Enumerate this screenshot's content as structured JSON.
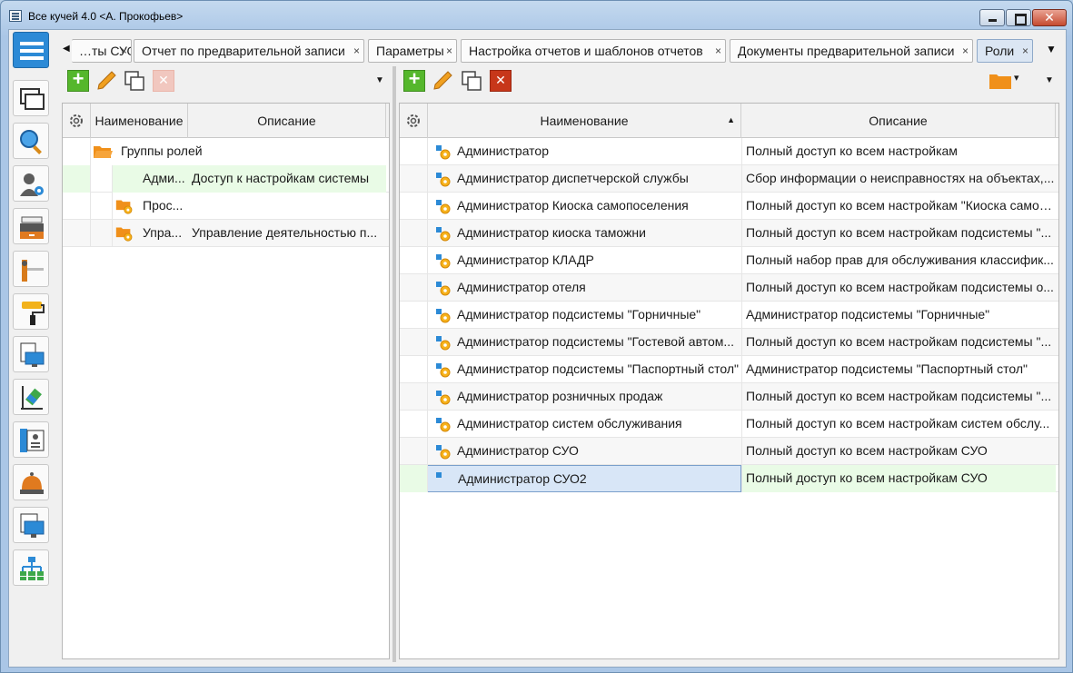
{
  "window": {
    "title": "Все кучей 4.0 <А. Прокофьев>"
  },
  "tabs": [
    {
      "label": "…ты СУО",
      "close": "×"
    },
    {
      "label": "Отчет по предварительной записи",
      "close": "×"
    },
    {
      "label": "Параметры",
      "close": "×"
    },
    {
      "label": "Настройка отчетов и шаблонов отчетов",
      "close": "×"
    },
    {
      "label": "Документы предварительной записи",
      "close": "×"
    },
    {
      "label": "Роли",
      "close": "×"
    }
  ],
  "tab_nav": {
    "left": "◀",
    "menu": "▼"
  },
  "left_panel": {
    "columns": {
      "name": "Наименование",
      "desc": "Описание"
    },
    "group": "Группы ролей",
    "rows": [
      {
        "name": "Адми...",
        "desc": "Доступ к настройкам системы"
      },
      {
        "name": "Прос...",
        "desc": ""
      },
      {
        "name": "Упра...",
        "desc": "Управление деятельностью п..."
      }
    ],
    "dropdown": "▼"
  },
  "right_panel": {
    "columns": {
      "name": "Наименование",
      "sort": "▲",
      "desc": "Описание"
    },
    "rows": [
      {
        "name": "Администратор",
        "desc": "Полный доступ ко всем настройкам"
      },
      {
        "name": "Администратор диспетчерской службы",
        "desc": "Сбор информации о неисправностях на объектах,..."
      },
      {
        "name": "Администратор Киоска самопоселения",
        "desc": "Полный доступ ко всем настройкам \"Киоска самоп..."
      },
      {
        "name": "Администратор киоска таможни",
        "desc": "Полный доступ ко всем настройкам подсистемы \"..."
      },
      {
        "name": "Администратор КЛАДР",
        "desc": "Полный набор прав для обслуживания классифик..."
      },
      {
        "name": "Администратор отеля",
        "desc": "Полный доступ ко всем настройкам подсистемы о..."
      },
      {
        "name": "Администратор подсистемы \"Горничные\"",
        "desc": "Администратор подсистемы \"Горничные\""
      },
      {
        "name": "Администратор подсистемы \"Гостевой автом...",
        "desc": "Полный доступ ко всем настройкам подсистемы \"..."
      },
      {
        "name": "Администратор подсистемы \"Паспортный стол\"",
        "desc": "Администратор подсистемы \"Паспортный стол\""
      },
      {
        "name": "Администратор розничных продаж",
        "desc": "Полный доступ ко всем настройкам подсистемы \"..."
      },
      {
        "name": "Администратор систем обслуживания",
        "desc": "Полный доступ ко всем настройкам систем обслу..."
      },
      {
        "name": "Администратор СУО",
        "desc": "Полный доступ ко всем настройкам СУО"
      },
      {
        "name": "Администратор СУО2",
        "desc": "Полный доступ ко всем настройкам СУО"
      }
    ],
    "dropdown": "▼",
    "folder_dropdown": "▾"
  },
  "sidebar_icons": [
    "menu-icon",
    "windows-icon",
    "search-icon",
    "user-settings-icon",
    "cash-register-icon",
    "barrier-icon",
    "paint-roller-icon",
    "monitor-document-icon",
    "eraser-icon",
    "book-id-icon",
    "service-bell-icon",
    "monitor-list-icon",
    "org-chart-icon"
  ],
  "colors": {
    "accent": "#2c8ad6",
    "add": "#55b72c",
    "delete": "#c7371a",
    "folder": "#f0901a",
    "selected": "#d8e6f7",
    "row_green": "#e9fbe6"
  }
}
